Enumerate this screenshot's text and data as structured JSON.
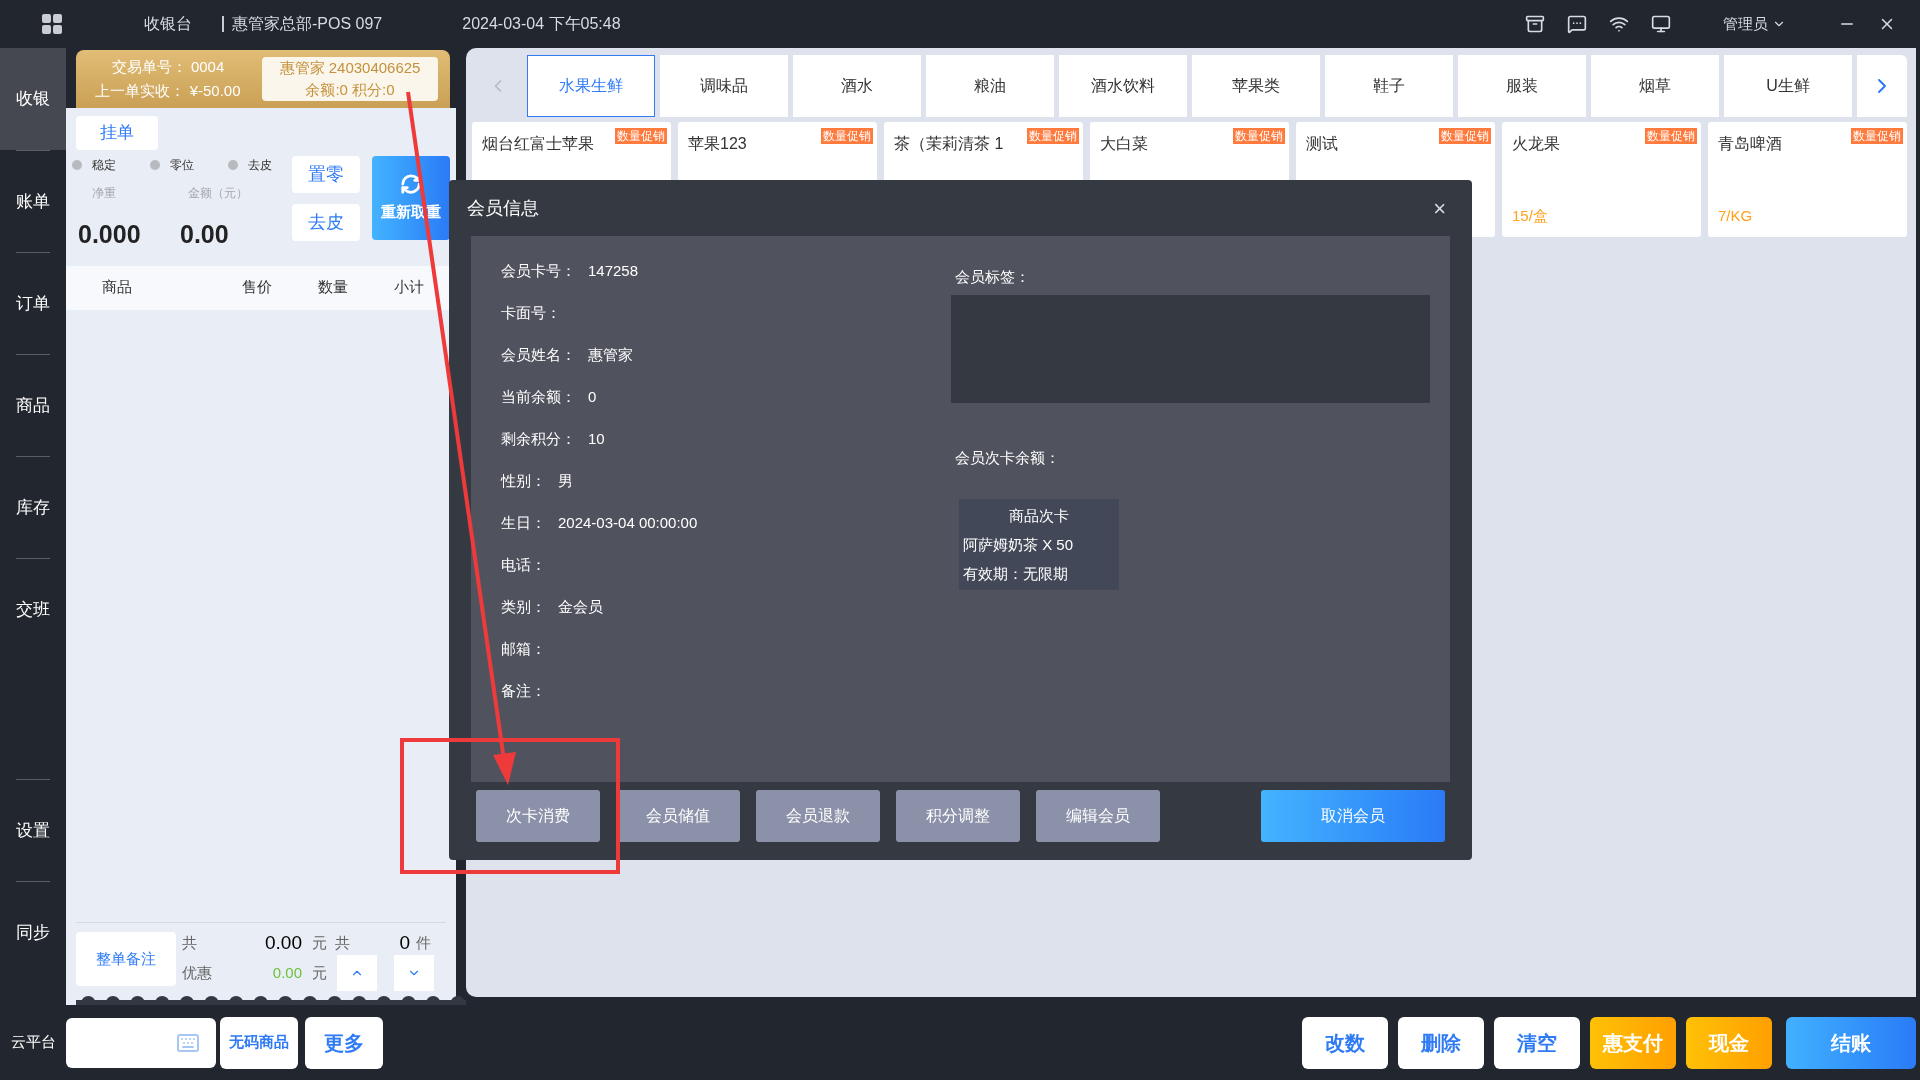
{
  "topbar": {
    "app": "收银台",
    "store": "惠管家总部-POS 097",
    "datetime": "2024-03-04 下午05:48",
    "user": "管理员"
  },
  "nav": [
    {
      "label": "收银",
      "selected": true
    },
    {
      "label": "账单",
      "selected": false
    },
    {
      "label": "订单",
      "selected": false
    },
    {
      "label": "商品",
      "selected": false
    },
    {
      "label": "库存",
      "selected": false
    },
    {
      "label": "交班",
      "selected": false
    },
    {
      "label": "设置",
      "selected": false
    },
    {
      "label": "同步",
      "selected": false
    }
  ],
  "nav_bottom": "云平台",
  "order": {
    "trade_no": "交易单号：  0004",
    "last_paid": "上一单实收：  ¥-50.00",
    "member_line1": "惠管家  24030406625",
    "member_line2": "余额:0 积分:0"
  },
  "hold_button": "挂单",
  "scale": {
    "indicators": [
      {
        "label": "稳定",
        "active": false
      },
      {
        "label": "零位",
        "active": false
      },
      {
        "label": "去皮",
        "active": false
      }
    ],
    "weight_label": "净重",
    "amount_label": "金额（元）",
    "weight": "0.000",
    "amount": "0.00",
    "zero_button": "置零",
    "tare_button": "去皮",
    "reweigh_button": "重新取重"
  },
  "cart": {
    "columns": [
      "商品",
      "售价",
      "数量",
      "小计"
    ]
  },
  "summary": {
    "note_button": "整单备注",
    "total_label": "共",
    "total": "0.00",
    "total_unit": "元",
    "count_label": "共",
    "count": "0",
    "count_unit": "件",
    "discount_label": "优惠",
    "discount": "0.00",
    "discount_unit": "元"
  },
  "bottom_left": {
    "barcode_buttons": [
      "无码商品",
      "更多"
    ]
  },
  "categories": [
    {
      "label": "水果生鲜",
      "selected": true
    },
    {
      "label": "调味品",
      "selected": false
    },
    {
      "label": "酒水",
      "selected": false
    },
    {
      "label": "粮油",
      "selected": false
    },
    {
      "label": "酒水饮料",
      "selected": false
    },
    {
      "label": "苹果类",
      "selected": false
    },
    {
      "label": "鞋子",
      "selected": false
    },
    {
      "label": "服装",
      "selected": false
    },
    {
      "label": "烟草",
      "selected": false
    },
    {
      "label": "U生鲜",
      "selected": false
    }
  ],
  "products": [
    {
      "name": "烟台红富士苹果",
      "badge": "数量促销"
    },
    {
      "name": "苹果123",
      "badge": "数量促销"
    },
    {
      "name": "茶（茉莉清茶  1",
      "badge": "数量促销"
    },
    {
      "name": "大白菜",
      "badge": "数量促销"
    },
    {
      "name": "测试",
      "badge": "数量促销"
    },
    {
      "name": "火龙果",
      "badge": "数量促销",
      "price": "15/盒"
    },
    {
      "name": "青岛啤酒",
      "badge": "数量促销",
      "price": "7/KG"
    }
  ],
  "actions": [
    {
      "label": "改数",
      "kind": "plain"
    },
    {
      "label": "删除",
      "kind": "plain"
    },
    {
      "label": "清空",
      "kind": "plain"
    },
    {
      "label": "惠支付",
      "kind": "pay"
    },
    {
      "label": "现金",
      "kind": "pay"
    },
    {
      "label": "结账",
      "kind": "checkout"
    }
  ],
  "dialog": {
    "title": "会员信息",
    "close": "×",
    "fields": [
      {
        "label": "会员卡号：",
        "value": "147258"
      },
      {
        "label": "卡面号："
      },
      {
        "label": "会员姓名：",
        "value": "惠管家"
      },
      {
        "label": "当前余额：",
        "value": "0"
      },
      {
        "label": "剩余积分：",
        "value": "10"
      },
      {
        "label": "性别：",
        "value": "男"
      },
      {
        "label": "生日：",
        "value": "2024-03-04 00:00:00"
      },
      {
        "label": "电话："
      },
      {
        "label": "类别：",
        "value": "金会员"
      },
      {
        "label": "邮箱："
      },
      {
        "label": "备注："
      }
    ],
    "tags_label": "会员标签：",
    "card_balance_label": "会员次卡余额：",
    "card": {
      "title": "商品次卡",
      "item": "阿萨姆奶茶 X 50",
      "validity": "有效期：无限期"
    },
    "buttons": [
      {
        "label": "次卡消费",
        "kind": "secondary"
      },
      {
        "label": "会员储值",
        "kind": "secondary"
      },
      {
        "label": "会员退款",
        "kind": "secondary"
      },
      {
        "label": "积分调整",
        "kind": "secondary"
      },
      {
        "label": "编辑会员",
        "kind": "secondary"
      },
      {
        "label": "取消会员",
        "kind": "primary"
      }
    ]
  }
}
